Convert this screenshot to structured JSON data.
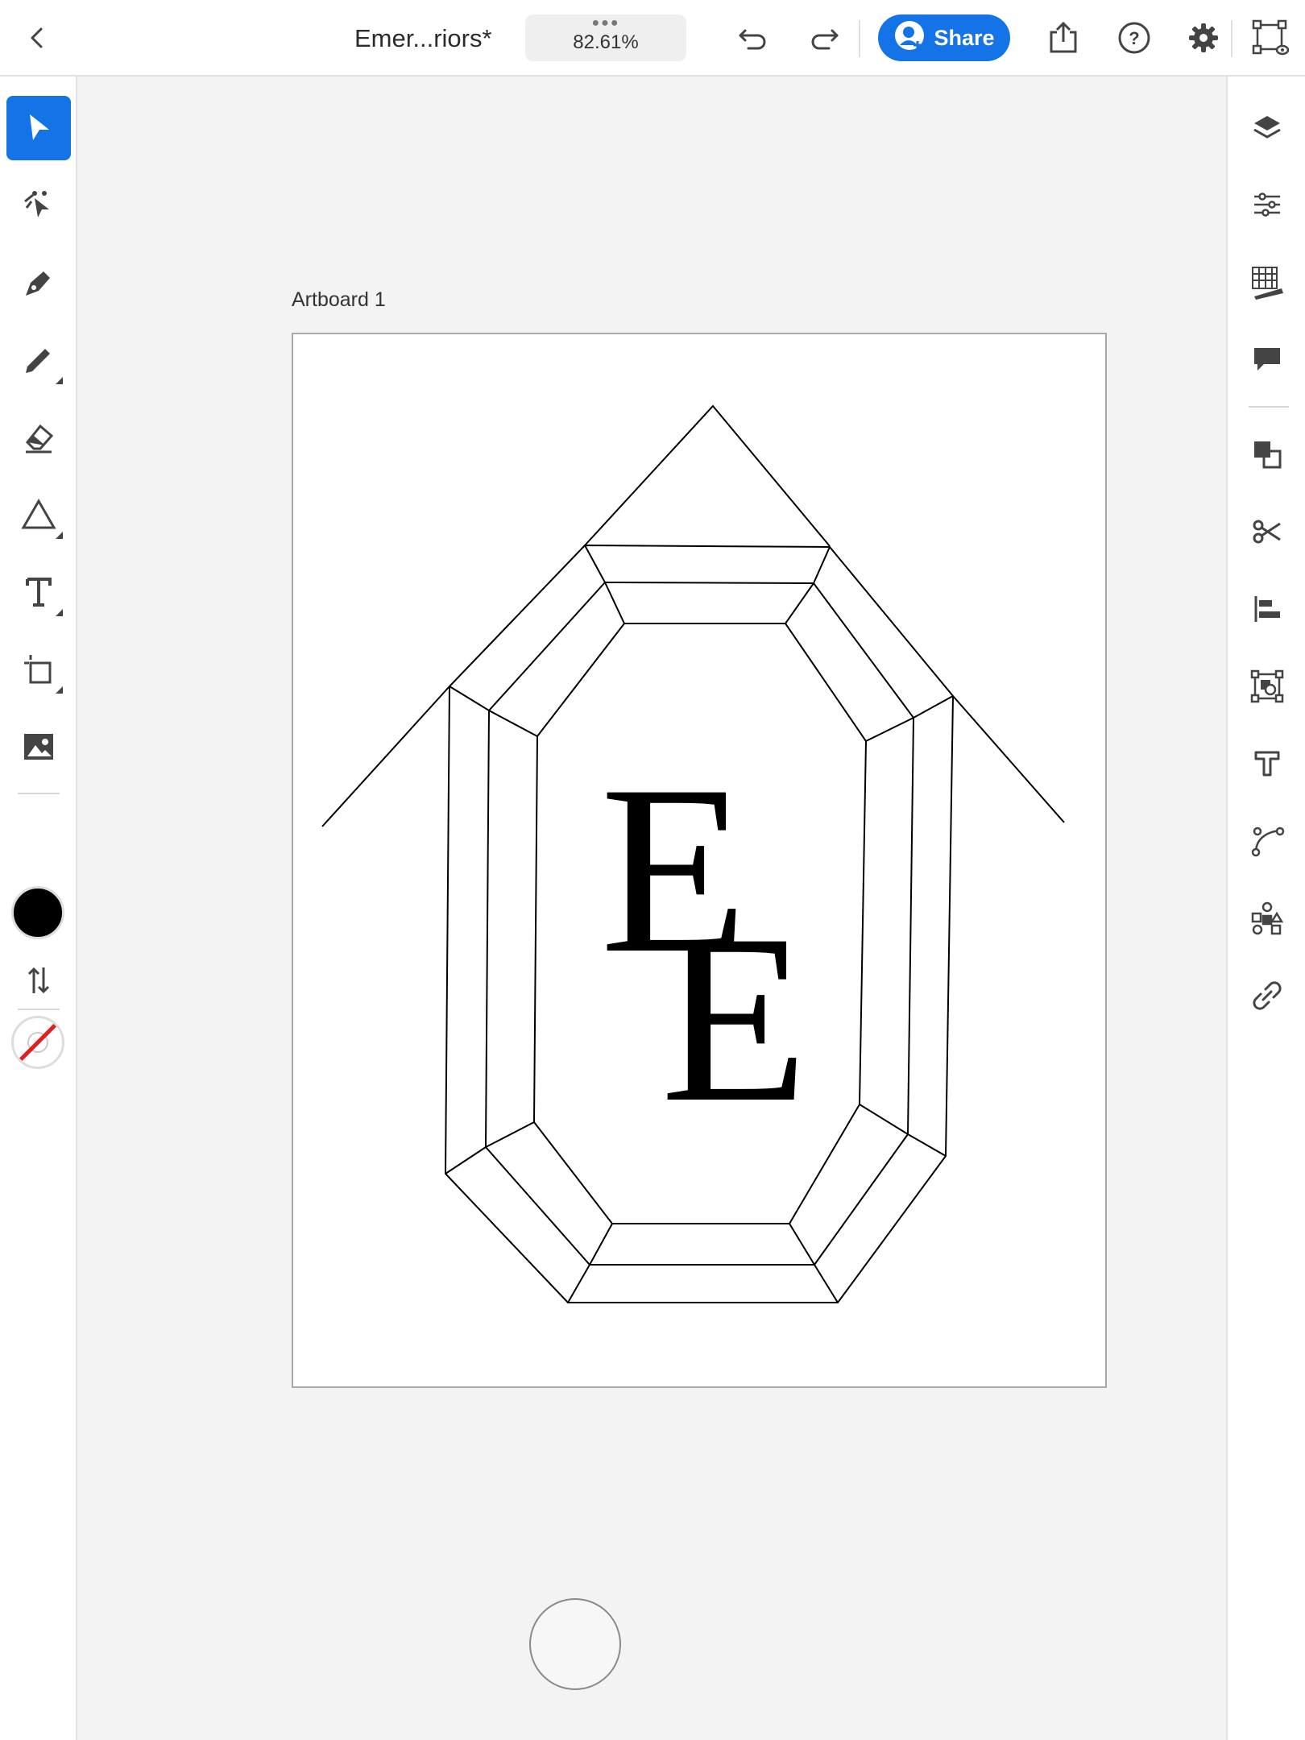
{
  "header": {
    "document_title": "Emer...riors*",
    "zoom_level": "82.61%",
    "share_label": "Share",
    "icons": [
      "back-chevron-icon",
      "undo-icon",
      "redo-icon",
      "share-user-icon",
      "export-icon",
      "help-icon",
      "gear-icon",
      "transform-icon"
    ]
  },
  "tools": {
    "items": [
      {
        "name": "selection-tool",
        "active": true
      },
      {
        "name": "direct-selection-tool"
      },
      {
        "name": "pen-tool"
      },
      {
        "name": "pencil-tool"
      },
      {
        "name": "eraser-tool"
      },
      {
        "name": "shape-tool"
      },
      {
        "name": "type-tool"
      },
      {
        "name": "transform-tool"
      },
      {
        "name": "image-tool"
      }
    ],
    "fill_color": "#000000",
    "stroke_color": "none"
  },
  "right_panel": {
    "items": [
      "layers-icon",
      "properties-icon",
      "grid-ruler-icon",
      "comments-icon",
      "arrange-icon",
      "cut-icon",
      "align-icon",
      "group-icon",
      "type-options-icon",
      "path-icon",
      "symbols-icon",
      "link-icon"
    ]
  },
  "canvas": {
    "artboard_label": "Artboard 1",
    "monogram": {
      "letter_1": "E",
      "letter_2": "E"
    }
  },
  "colors": {
    "accent": "#1473e6",
    "canvas_bg": "#f3f3f3",
    "artboard_bg": "#ffffff"
  }
}
